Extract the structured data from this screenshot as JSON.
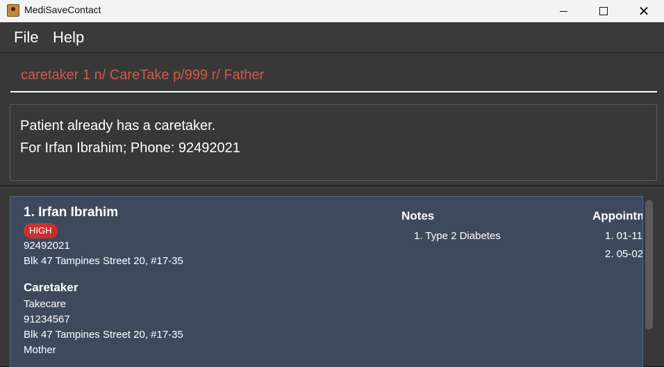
{
  "window": {
    "title": "MediSaveContact",
    "controls": {
      "minimize": "",
      "maximize": "",
      "close": "✕"
    }
  },
  "menu": {
    "file": "File",
    "help": "Help"
  },
  "command": {
    "value": "caretaker 1 n/ CareTake p/999 r/ Father"
  },
  "result": {
    "line1": "Patient already has a caretaker.",
    "line2": "For Irfan Ibrahim; Phone: 92492021"
  },
  "patients": [
    {
      "name": "1.  Irfan Ibrahim",
      "priority": "HIGH",
      "phone": "92492021",
      "address": "Blk 47 Tampines Street 20, #17-35",
      "caretaker": {
        "title": "Caretaker",
        "name": "Takecare",
        "phone": "91234567",
        "address": "Blk 47 Tampines Street 20, #17-35",
        "relationship": "Mother"
      },
      "notes": {
        "title": "Notes",
        "items": [
          "1.  Type 2 Diabetes"
        ]
      },
      "appointments": {
        "title": "Appointments",
        "items": [
          "1.  01-11",
          "2.  05-02"
        ]
      }
    }
  ],
  "colors": {
    "command_text": "#d05a4a",
    "card_bg": "#3e4a5c",
    "badge_high": "#c9312f"
  }
}
